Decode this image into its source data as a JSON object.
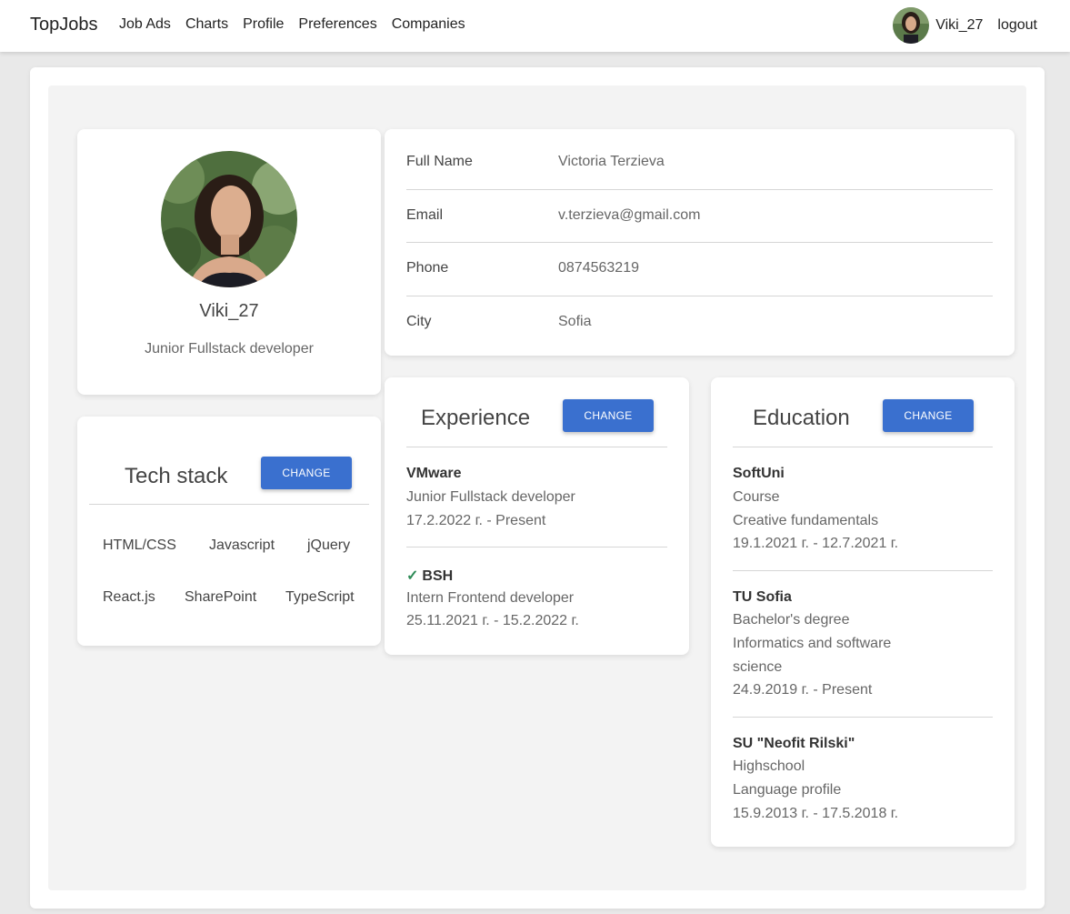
{
  "nav": {
    "brand": "TopJobs",
    "links": [
      "Job Ads",
      "Charts",
      "Profile",
      "Preferences",
      "Companies"
    ],
    "username": "Viki_27",
    "logout": "logout"
  },
  "profile": {
    "username": "Viki_27",
    "title": "Junior Fullstack developer"
  },
  "info": {
    "rows": [
      {
        "label": "Full Name",
        "value": "Victoria Terzieva"
      },
      {
        "label": "Email",
        "value": "v.terzieva@gmail.com"
      },
      {
        "label": "Phone",
        "value": "0874563219"
      },
      {
        "label": "City",
        "value": "Sofia"
      }
    ]
  },
  "tech": {
    "title": "Tech stack",
    "change_label": "CHANGE",
    "items": [
      "HTML/CSS",
      "Javascript",
      "jQuery",
      "React.js",
      "SharePoint",
      "TypeScript"
    ]
  },
  "experience": {
    "title": "Experience",
    "change_label": "CHANGE",
    "entries": [
      {
        "company": "VMware",
        "role": "Junior Fullstack developer",
        "period": "17.2.2022 г. - Present",
        "checked": false
      },
      {
        "company": "BSH",
        "role": "Intern Frontend developer",
        "period": "25.11.2021 г. - 15.2.2022 г.",
        "checked": true
      }
    ]
  },
  "education": {
    "title": "Education",
    "change_label": "CHANGE",
    "entries": [
      {
        "school": "SoftUni",
        "degree": "Course",
        "field": "Creative fundamentals",
        "period": "19.1.2021 г. - 12.7.2021 г."
      },
      {
        "school": "TU Sofia",
        "degree": "Bachelor's degree",
        "field_line1": "Informatics and software",
        "field_line2": "science",
        "period": "24.9.2019 г. - Present"
      },
      {
        "school": "SU \"Neofit Rilski\"",
        "degree": "Highschool",
        "field": "Language profile",
        "period": "15.9.2013 г. - 17.5.2018 г."
      }
    ]
  },
  "colors": {
    "accent": "#3a70cf",
    "check": "#2e8b57",
    "background": "#e9e9e9"
  }
}
